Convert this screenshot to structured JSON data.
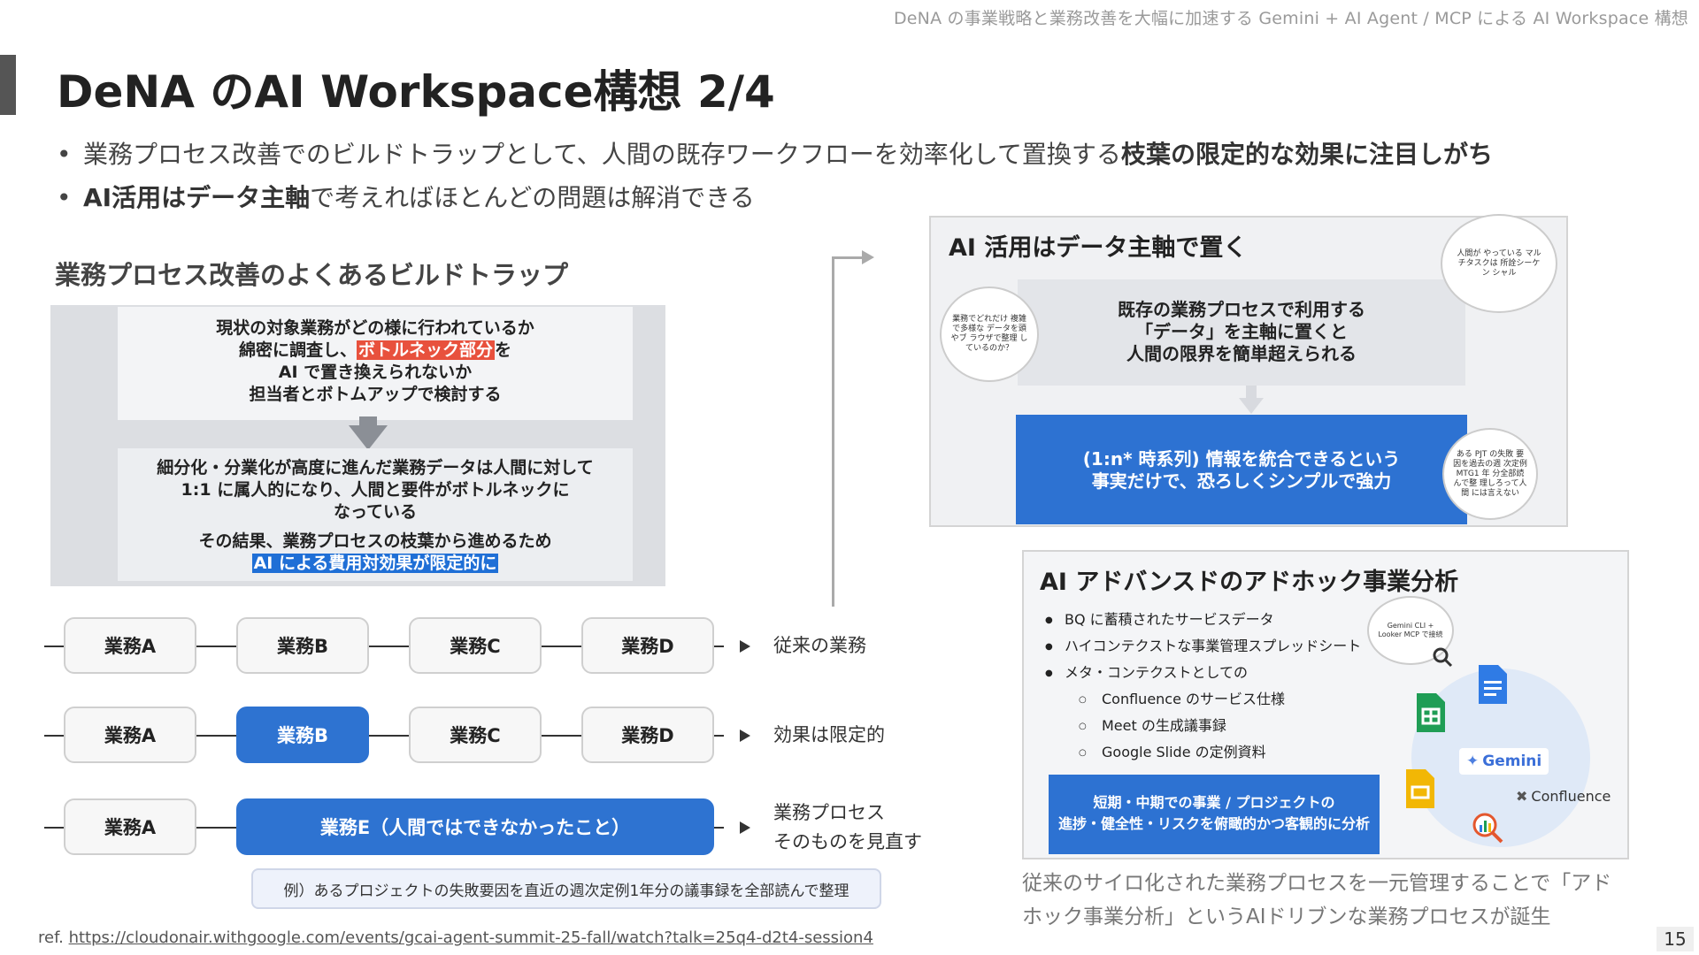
{
  "header_note": "DeNA の事業戦略と業務改善を大幅に加速する Gemini + AI Agent / MCP による AI Workspace 構想",
  "title": "DeNA のAI Workspace構想 2/4",
  "bullets": [
    {
      "text": "業務プロセス改善でのビルドトラップとして、人間の既存ワークフローを効率化して置換する",
      "bold": "枝葉の限定的な効果に注目しがち"
    },
    {
      "bold": "AI活用はデータ主軸",
      "text": "で考えればほとんどの問題は解消できる"
    }
  ],
  "left_section_title": "業務プロセス改善のよくあるビルドトラップ",
  "left_panel": {
    "top_line1": "現状の対象業務がどの様に行われているか",
    "top_line2_pre": "綿密に調査し、",
    "top_line2_hl": "ボトルネック部分",
    "top_line2_post": "を",
    "top_line3": "AI で置き換えられないか",
    "top_line4": "担当者とボトムアップで検討する",
    "bottom_line1": "細分化・分業化が高度に進んだ業務データは人間に対して",
    "bottom_line2": "1:1 に属人的になり、人間と要件がボトルネックに",
    "bottom_line3": "なっている",
    "bottom_line4": "その結果、業務プロセスの枝葉から進めるため",
    "bottom_line5_hl": "AI による費用対効果が限定的に"
  },
  "flow": {
    "row1": {
      "boxes": [
        "業務A",
        "業務B",
        "業務C",
        "業務D"
      ],
      "label": "従来の業務"
    },
    "row2": {
      "boxes": [
        "業務A",
        "業務B",
        "業務C",
        "業務D"
      ],
      "label": "効果は限定的"
    },
    "row3": {
      "box_a": "業務A",
      "box_e": "業務E（人間ではできなかったこと）",
      "label_line1": "業務プロセス",
      "label_line2": "そのものを見直す"
    },
    "example": "例）あるプロジェクトの失敗要因を直近の週次定例1年分の議事録を全部読んで整理"
  },
  "card_data_axis": {
    "title": "AI 活用はデータ主軸で置く",
    "inner_line1": "既存の業務プロセスで利用する",
    "inner_line2": "「データ」を主軸に置くと",
    "inner_line3": "人間の限界を簡単超えられる",
    "blue_line1": "(1:n* 時系列) 情報を統合できるという",
    "blue_line2": "事実だけで、恐ろしくシンプルで強力",
    "bubble_left": "業務でどれだけ 複雑で多様な データを頭やブ ラウザで整理 しているのか？",
    "bubble_top_right": "人間が やっている マルチタスクは 所詮シーケン シャル",
    "bubble_bottom_right": "ある PJT の失敗 要因を過去の週 次定例MTG1 年 分全部読んで整 理しろって人間 には言えない"
  },
  "card_adhoc": {
    "title": "AI アドバンスドのアドホック事業分析",
    "items": [
      "BQ に蓄積されたサービスデータ",
      "ハイコンテクストな事業管理スプレッドシート",
      "メタ・コンテクストとしての"
    ],
    "subitems": [
      "Confluence のサービス仕様",
      "Meet の生成議事録",
      "Google Slide の定例資料"
    ],
    "blue_line1": "短期・中期での事業 / プロジェクトの",
    "blue_line2": "進捗・健全性・リスクを俯瞰的かつ客観的に分析",
    "bubble": "Gemini CLI + Looker MCP で接続",
    "gemini_label": "Gemini",
    "confluence_label": "Confluence"
  },
  "caption": "従来のサイロ化された業務プロセスを一元管理することで「アドホック事業分析」というAIドリブンな業務プロセスが誕生",
  "ref_prefix": "ref.",
  "ref_url": "https://cloudonair.withgoogle.com/events/gcai-agent-summit-25-fall/watch?talk=25q4-d2t4-session4",
  "page_number": "15",
  "colors": {
    "accent_blue": "#2e73d1",
    "highlight_red": "#e8513d",
    "accent_bar": "#555555"
  }
}
